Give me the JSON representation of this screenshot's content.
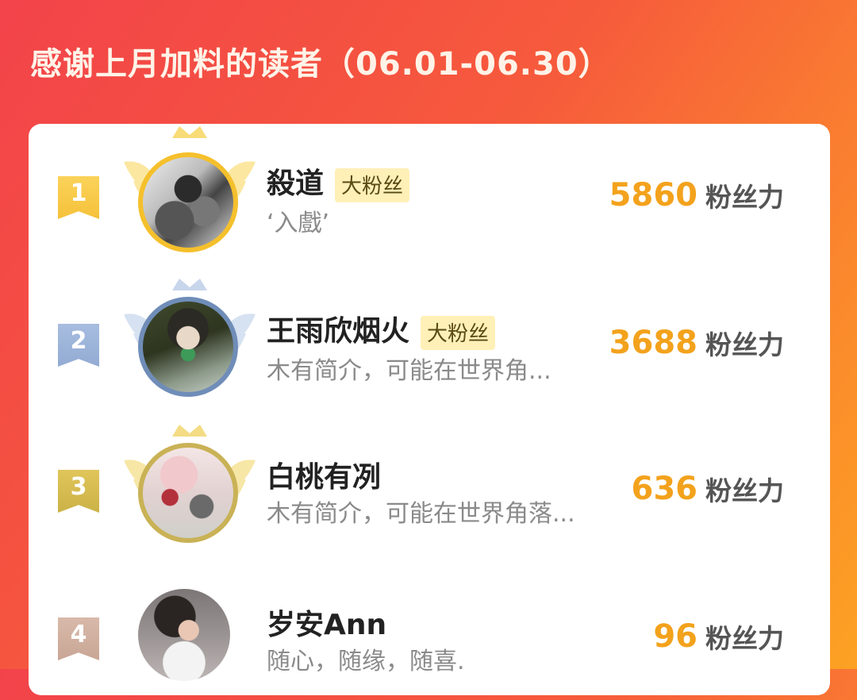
{
  "header": {
    "title": "感谢上月加料的读者（06.01-06.30）"
  },
  "readers": [
    {
      "rank": "1",
      "name": "殺道",
      "badge": "大粉丝",
      "bio": "‘入戲’",
      "score": "5860",
      "unit": "粉丝力"
    },
    {
      "rank": "2",
      "name": "王雨欣烟火",
      "badge": "大粉丝",
      "bio": "木有简介，可能在世界角...",
      "score": "3688",
      "unit": "粉丝力"
    },
    {
      "rank": "3",
      "name": "白桃有冽",
      "badge": "",
      "bio": "木有简介，可能在世界角落...",
      "score": "636",
      "unit": "粉丝力"
    },
    {
      "rank": "4",
      "name": "岁安Ann",
      "badge": "",
      "bio": "随心，随缘，随喜.",
      "score": "96",
      "unit": "粉丝力"
    }
  ],
  "colors": {
    "accent": "#f3a21c",
    "gold": "#f5c02c",
    "silver": "#93abd3",
    "bronze": "#cbb247",
    "fourth": "#c9a696"
  },
  "icons": [
    "gold-crown-wings-icon",
    "silver-crown-wings-icon",
    "bronze-crown-wings-icon"
  ]
}
